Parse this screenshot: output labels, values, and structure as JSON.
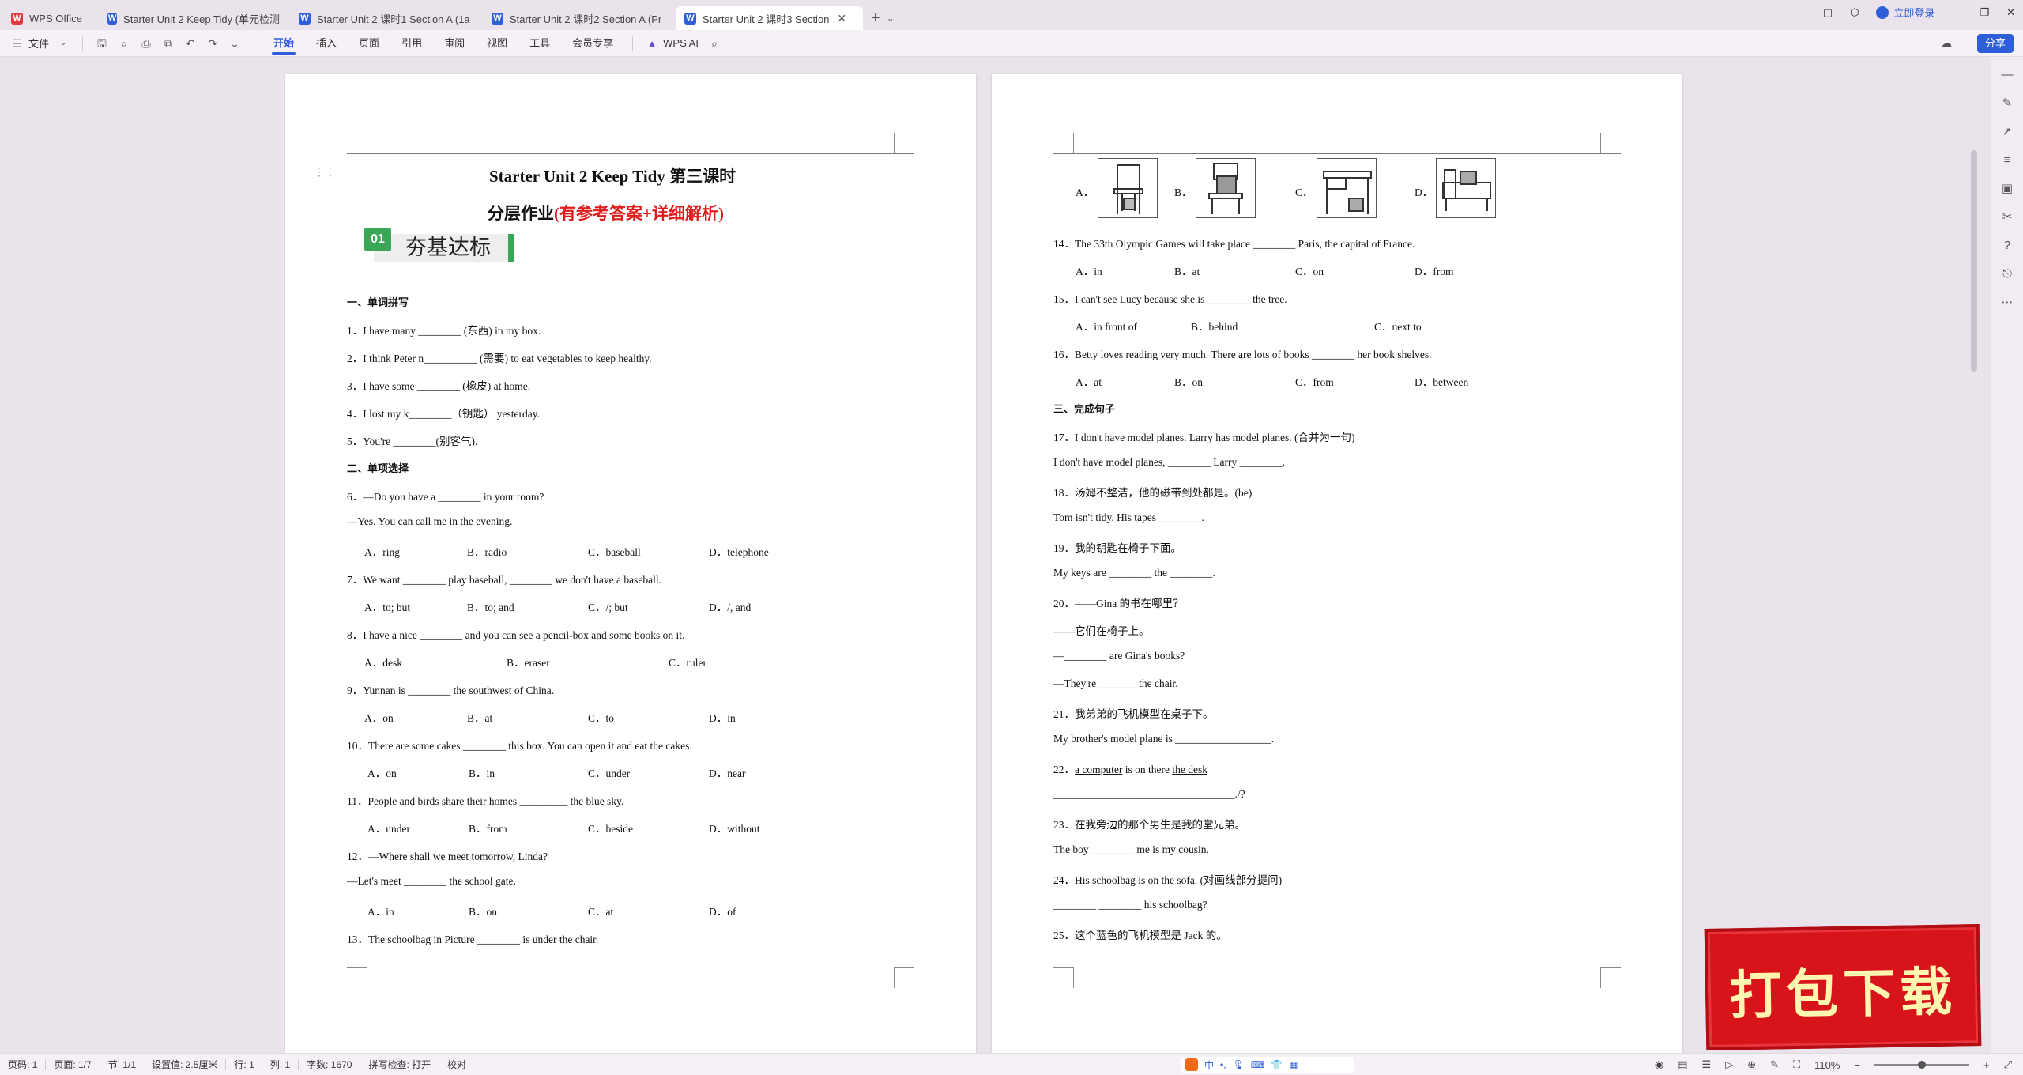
{
  "tabs": [
    {
      "label": "WPS Office",
      "icon": "wps-logo-icon",
      "active": false
    },
    {
      "label": "Starter Unit 2 Keep Tidy (单元检测",
      "icon": "word-doc-icon",
      "active": false
    },
    {
      "label": "Starter Unit 2 课时1 Section A (1a",
      "icon": "word-doc-icon",
      "active": false
    },
    {
      "label": "Starter Unit 2 课时2 Section A (Pr",
      "icon": "word-doc-icon",
      "active": false
    },
    {
      "label": "Starter Unit 2 课时3 Section",
      "icon": "word-doc-icon",
      "active": true
    }
  ],
  "window": {
    "login": "立即登录"
  },
  "menu": {
    "file": "文件",
    "items": [
      "开始",
      "插入",
      "页面",
      "引用",
      "审阅",
      "视图",
      "工具",
      "会员专享"
    ],
    "active": "开始",
    "wps_ai": "WPS AI",
    "share": "分享"
  },
  "page1": {
    "title": "Starter Unit 2 Keep Tidy  第三课时",
    "subtitle_black": "分层作业",
    "subtitle_red": "(有参考答案+详细解析)",
    "badge_num": "01",
    "badge_text": "夯基达标",
    "section1": "一、单词拼写",
    "q1": "1．I have many  ________  (东西) in my box.",
    "q2": "2．I think Peter n__________ (需要) to eat vegetables to keep healthy.",
    "q3": "3．I have some  ________  (橡皮) at home.",
    "q4": "4．I lost my k________（钥匙）  yesterday.",
    "q5": "5．You're  ________(别客气).",
    "section2": "二、单项选择",
    "q6": "6．—Do you have a ________ in your room?",
    "q6b": "—Yes. You can call me in the evening.",
    "q6o": [
      "A．ring",
      "B．radio",
      "C．baseball",
      "D．telephone"
    ],
    "q7": "7．We want ________ play baseball, ________ we don't have a baseball.",
    "q7o": [
      "A．to; but",
      "B．to; and",
      "C．/; but",
      "D．/, and"
    ],
    "q8": "8．I have a nice ________ and you can see a pencil-box and some books on it.",
    "q8o": [
      "A．desk",
      "B．eraser",
      "C．ruler"
    ],
    "q9": "9．Yunnan is ________ the southwest of China.",
    "q9o": [
      "A．on",
      "B．at",
      "C．to",
      "D．in"
    ],
    "q10": "10．There are some cakes ________ this box. You can open it and eat the cakes.",
    "q10o": [
      "A．on",
      "B．in",
      "C．under",
      "D．near"
    ],
    "q11": "11．People and birds share their homes _________ the blue sky.",
    "q11o": [
      "A．under",
      "B．from",
      "C．beside",
      "D．without"
    ],
    "q12": "12．—Where shall we meet tomorrow, Linda?",
    "q12b": "—Let's meet ________ the school gate.",
    "q12o": [
      "A．in",
      "B．on",
      "C．at",
      "D．of"
    ],
    "q13": "13．The schoolbag in Picture ________ is under the chair."
  },
  "page2": {
    "q13o": [
      "A．",
      "B．",
      "C．",
      "D．"
    ],
    "q14": "14．The 33th Olympic Games will take place ________ Paris, the capital of France.",
    "q14o": [
      "A．in",
      "B．at",
      "C．on",
      "D．from"
    ],
    "q15": "15．I can't see Lucy because she is ________ the tree.",
    "q15o": [
      "A．in front of",
      "B．behind",
      "C．next to"
    ],
    "q16": "16．Betty loves reading very much. There are lots of books ________ her book shelves.",
    "q16o": [
      "A．at",
      "B．on",
      "C．from",
      "D．between"
    ],
    "section3": "三、完成句子",
    "q17": "17．I don't have model planes. Larry has model planes. (合并为一句)",
    "q17b": "I don't have model planes,  ________  Larry  ________.",
    "q18": "18．汤姆不整洁，他的磁带到处都是。(be)",
    "q18b": "Tom isn't tidy. His tapes  ________.",
    "q19": "19．我的钥匙在椅子下面。",
    "q19b": "My keys are  ________  the  ________.",
    "q20": "20．——Gina 的书在哪里？",
    "q20b": "——它们在椅子上。",
    "q20c": "—________  are Gina's books?",
    "q20d": "—They're  _______  the chair.",
    "q21": "21．我弟弟的飞机模型在桌子下。",
    "q21b": "My brother's model plane is  __________________.",
    "q22_num": "22．",
    "q22_u1": "a computer",
    "q22_mid": " is  on  there ",
    "q22_u2": "the desk",
    "q22b": "__________________________________./?",
    "q23": "23．在我旁边的那个男生是我的堂兄弟。",
    "q23b": "The boy  ________  me is my cousin.",
    "q24_pre": "24．His schoolbag is ",
    "q24_u": "on the sofa",
    "q24_post": ". (对画线部分提问)",
    "q24b": "________  ________  his schoolbag?",
    "q25": "25．这个蓝色的飞机模型是 Jack 的。"
  },
  "status": {
    "page_no": "页码: 1",
    "pages": "页面: 1/7",
    "section": "节: 1/1",
    "setting": "设置值: 2.5厘米",
    "row": "行: 1",
    "col": "列: 1",
    "words": "字数: 1670",
    "spell": "拼写检查: 打开",
    "proof": "校对",
    "zoom": "110%"
  },
  "stamp": {
    "text": "打包下载"
  }
}
